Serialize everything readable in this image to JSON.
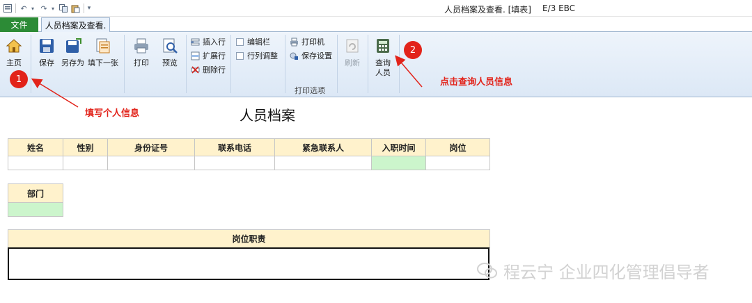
{
  "window": {
    "title": "人员档案及查看. [填表]",
    "app": "E/3 EBC"
  },
  "tabs": {
    "file": "文件",
    "active": "人员档案及查看."
  },
  "ribbon": {
    "home": "主页",
    "save": "保存",
    "save_as": "另存为",
    "fill_next": "填下一张",
    "print": "打印",
    "preview": "预览",
    "insert_row": "插入行",
    "expand_row": "扩展行",
    "delete_row": "删除行",
    "edit_bar": "编辑栏",
    "row_adjust": "行列调整",
    "printer": "打印机",
    "save_settings": "保存设置",
    "print_options": "打印选项",
    "refresh": "刷新",
    "query_line1": "查询",
    "query_line2": "人员"
  },
  "annotations": {
    "badge1": "1",
    "badge2": "2",
    "note1": "填写个人信息",
    "note2": "点击查询人员信息",
    "color": "#e2231a"
  },
  "form": {
    "title": "人员档案",
    "columns": [
      "姓名",
      "性别",
      "身份证号",
      "联系电话",
      "紧急联系人",
      "入职时间",
      "岗位"
    ],
    "dept_label": "部门",
    "duty_label": "岗位职责"
  },
  "watermark": "程云宁 企业四化管理倡导者"
}
